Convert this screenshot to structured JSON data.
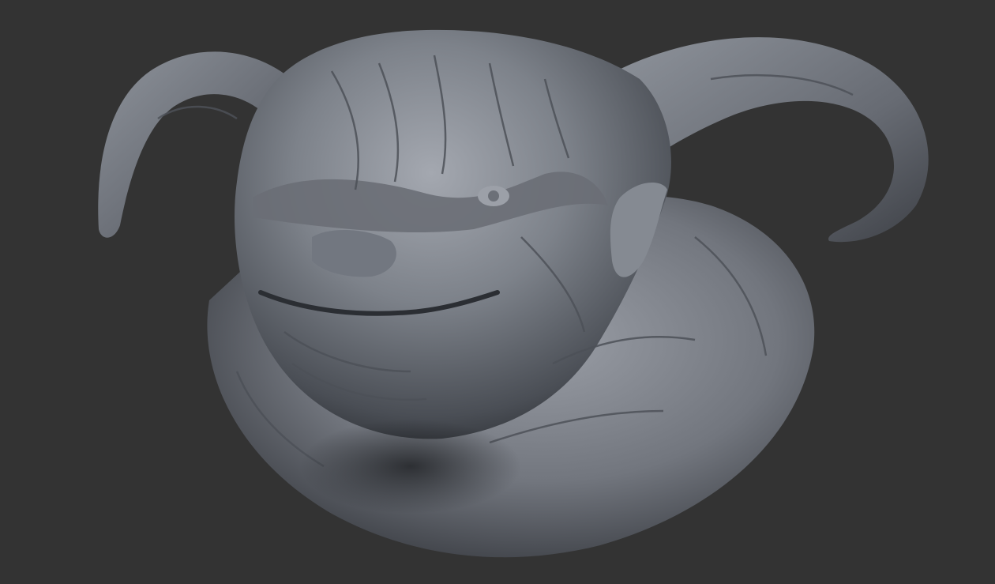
{
  "viewport": {
    "background_color": "#333333",
    "subject": "sculpt-render",
    "material_color": "#8a8e95"
  }
}
